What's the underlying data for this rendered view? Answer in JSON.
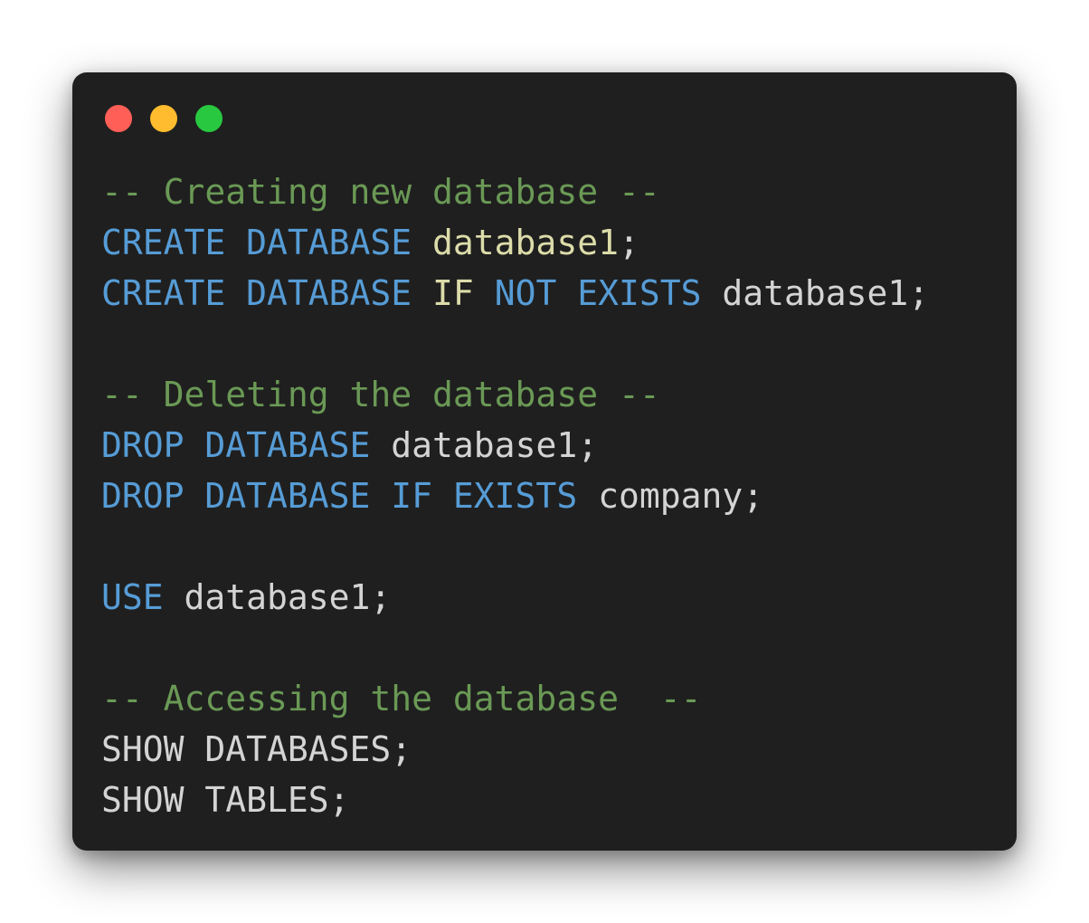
{
  "colors": {
    "background": "#ffffff",
    "window": "#1f1f1f",
    "close": "#ff5f57",
    "minimize": "#febc2e",
    "zoom": "#28c840",
    "comment": "#6a9955",
    "keyword": "#569cd6",
    "plain": "#d4d4d4",
    "identifier": "#dcdcaa"
  },
  "window_controls": [
    {
      "name": "close-dot",
      "color": "#ff5f57"
    },
    {
      "name": "minimize-dot",
      "color": "#febc2e"
    },
    {
      "name": "zoom-dot",
      "color": "#28c840"
    }
  ],
  "code_lines": [
    [
      {
        "t": "-- Creating new database --",
        "c": "comment"
      }
    ],
    [
      {
        "t": "CREATE DATABASE ",
        "c": "keyword"
      },
      {
        "t": "database1",
        "c": "identifier"
      },
      {
        "t": ";",
        "c": "plain"
      }
    ],
    [
      {
        "t": "CREATE DATABASE ",
        "c": "keyword"
      },
      {
        "t": "IF ",
        "c": "identifier"
      },
      {
        "t": "NOT EXISTS ",
        "c": "keyword"
      },
      {
        "t": "database1;",
        "c": "plain"
      }
    ],
    [],
    [
      {
        "t": "-- Deleting the database --",
        "c": "comment"
      }
    ],
    [
      {
        "t": "DROP DATABASE ",
        "c": "keyword"
      },
      {
        "t": "database1;",
        "c": "plain"
      }
    ],
    [
      {
        "t": "DROP DATABASE IF EXISTS ",
        "c": "keyword"
      },
      {
        "t": "company;",
        "c": "plain"
      }
    ],
    [],
    [
      {
        "t": "USE ",
        "c": "keyword"
      },
      {
        "t": "database1;",
        "c": "plain"
      }
    ],
    [],
    [
      {
        "t": "-- Accessing the database  --",
        "c": "comment"
      }
    ],
    [
      {
        "t": "SHOW DATABASES;",
        "c": "plain"
      }
    ],
    [
      {
        "t": "SHOW TABLES;",
        "c": "plain"
      }
    ]
  ]
}
